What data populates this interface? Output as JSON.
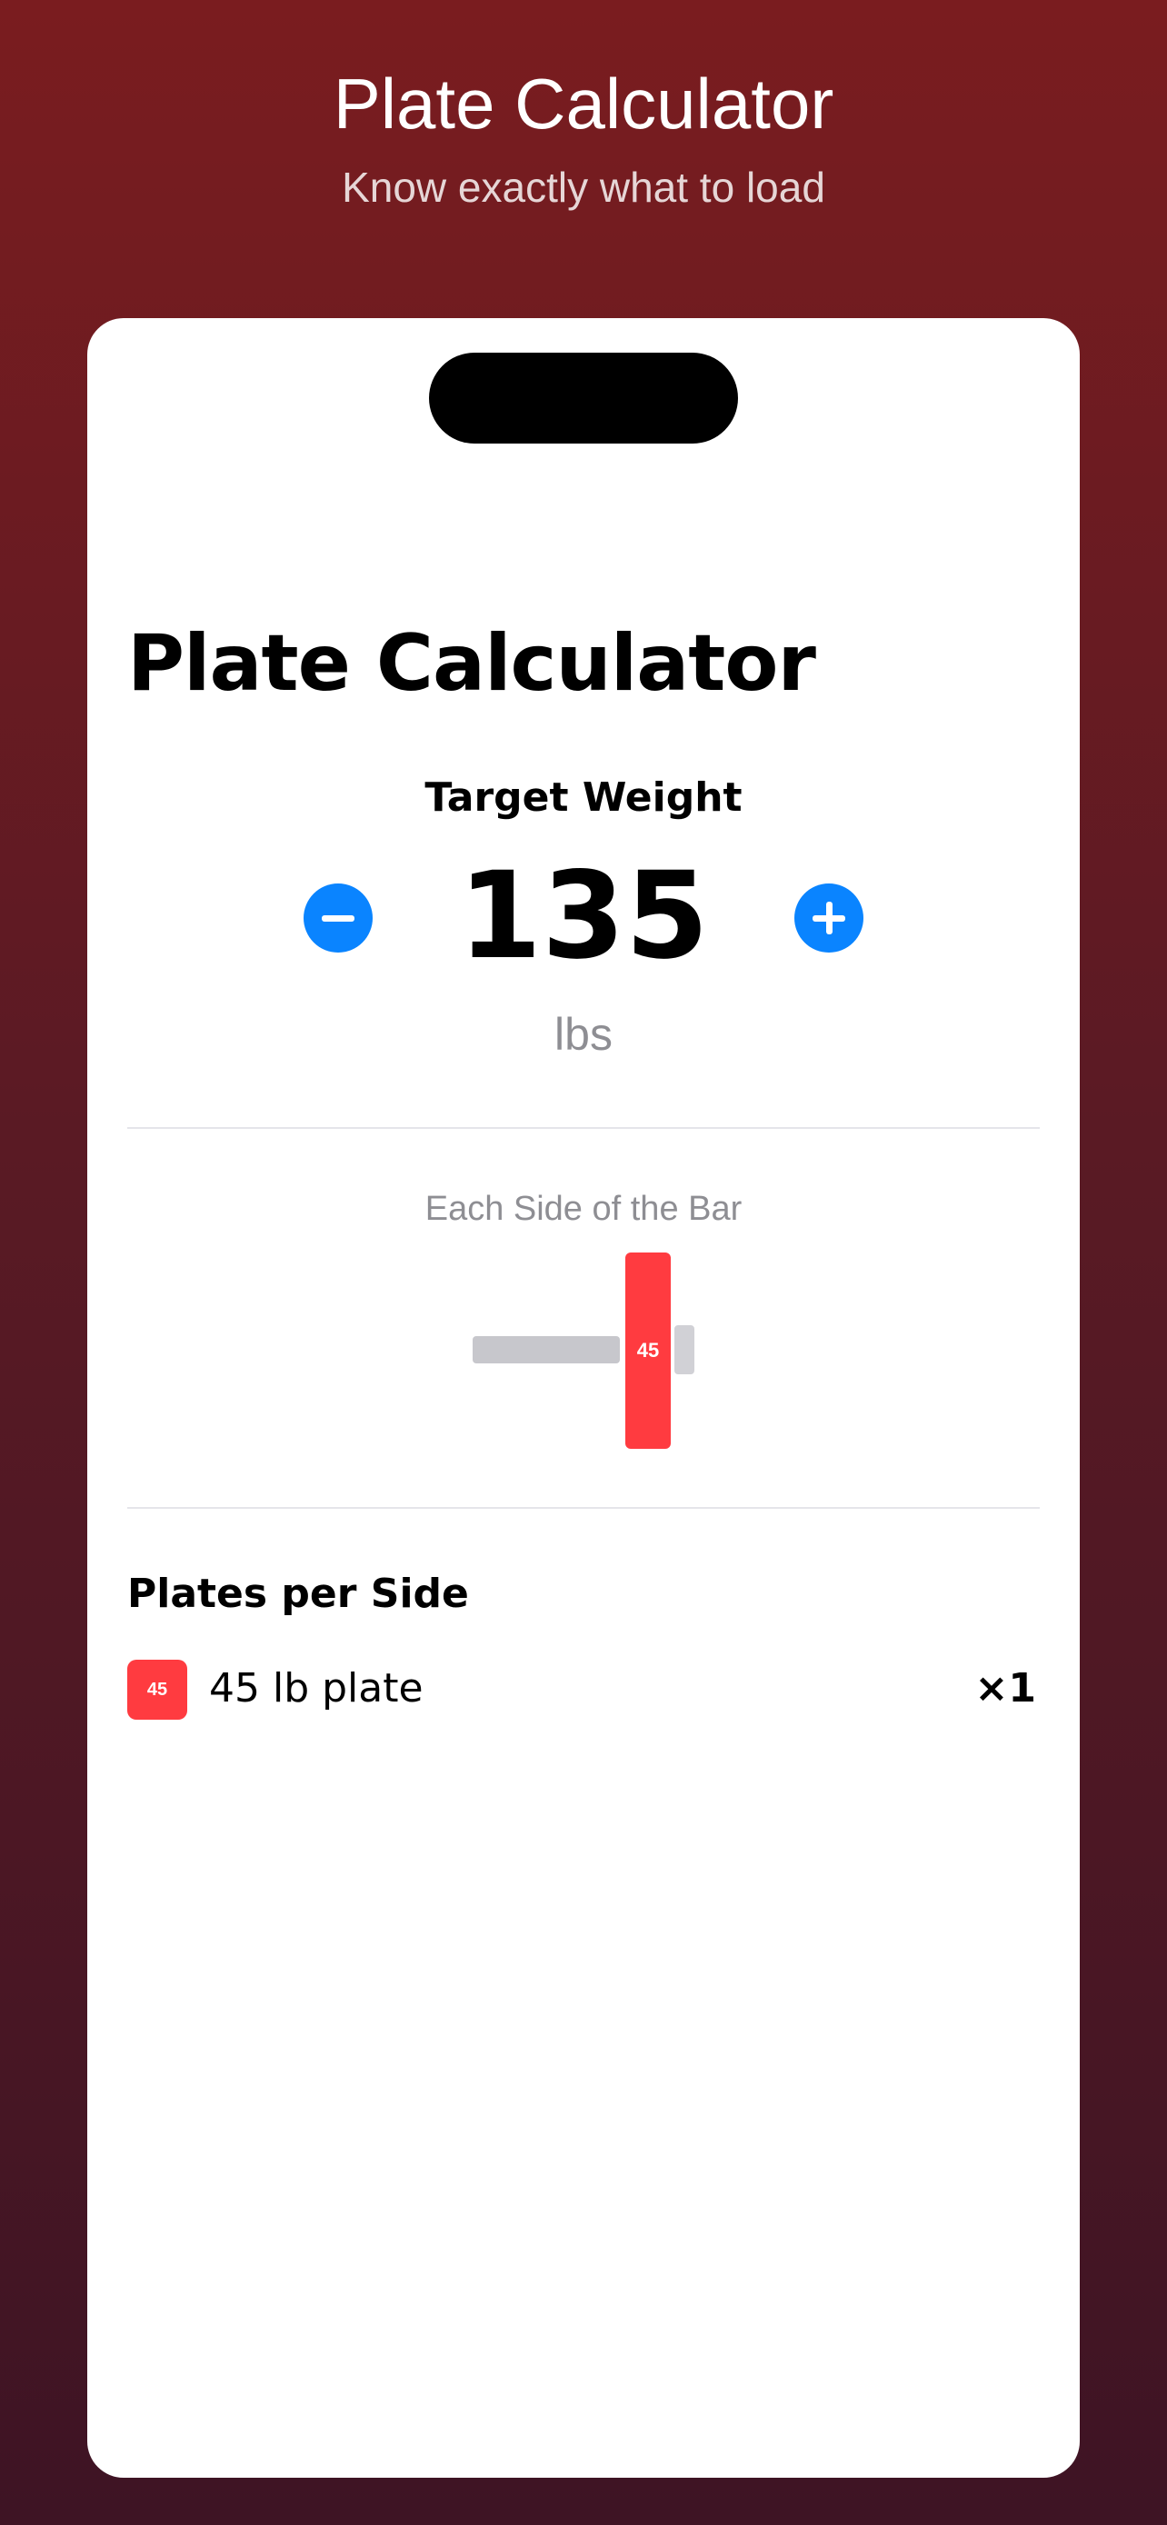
{
  "promo": {
    "title": "Plate Calculator",
    "subtitle": "Know exactly what to load"
  },
  "screen": {
    "title": "Plate Calculator",
    "target_label": "Target Weight",
    "weight": "135",
    "unit": "lbs",
    "decrement_icon": "minus-circle-icon",
    "increment_icon": "plus-circle-icon"
  },
  "bar_visual": {
    "caption": "Each Side of the Bar",
    "plates": [
      {
        "label": "45",
        "color": "#ff3b40"
      }
    ]
  },
  "plates_per_side": {
    "header": "Plates per Side",
    "items": [
      {
        "swatch_label": "45",
        "name": "45 lb plate",
        "count": "×1",
        "color": "#ff3b40"
      }
    ]
  },
  "colors": {
    "accent": "#0a84ff",
    "plate_45": "#ff3b40",
    "background_top": "#7a1c1f",
    "background_bottom": "#3e1424"
  }
}
